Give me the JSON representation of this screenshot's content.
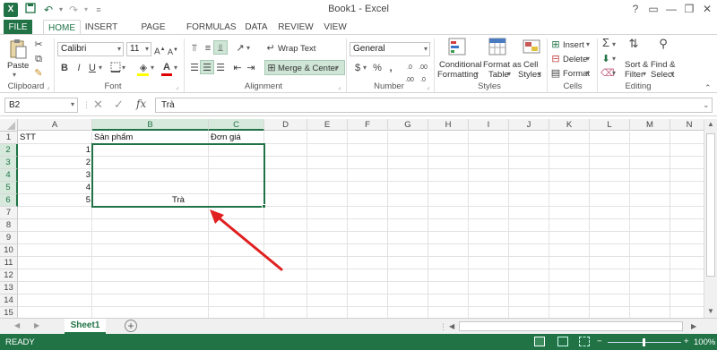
{
  "window": {
    "title": "Book1 - Excel",
    "controls": [
      "?",
      "▭",
      "—",
      "❐",
      "✕"
    ]
  },
  "ribbon_tabs": [
    "FILE",
    "HOME",
    "INSERT",
    "PAGE LAYOUT",
    "FORMULAS",
    "DATA",
    "REVIEW",
    "VIEW"
  ],
  "ribbon": {
    "clipboard": {
      "paste": "Paste",
      "label": "Clipboard"
    },
    "font": {
      "name": "Calibri",
      "size": "11",
      "bold": "B",
      "italic": "I",
      "underline": "U",
      "label": "Font"
    },
    "alignment": {
      "wrap_text": "Wrap Text",
      "merge_center": "Merge & Center",
      "label": "Alignment"
    },
    "number": {
      "format": "General",
      "currency": "$",
      "percent": "%",
      "comma": ",",
      "label": "Number"
    },
    "styles": {
      "conditional": [
        "Conditional",
        "Formatting"
      ],
      "format_as": [
        "Format as",
        "Table"
      ],
      "cell_styles": [
        "Cell",
        "Styles"
      ],
      "label": "Styles"
    },
    "cells": {
      "insert": "Insert",
      "delete": "Delete",
      "format": "Format",
      "label": "Cells"
    },
    "editing": {
      "sort": [
        "Sort &",
        "Filter"
      ],
      "find": [
        "Find &",
        "Select"
      ],
      "label": "Editing"
    }
  },
  "formula_bar": {
    "name_box": "B2",
    "fx": "fx",
    "value": "Trà"
  },
  "columns": [
    "A",
    "B",
    "C",
    "D",
    "E",
    "F",
    "G",
    "H",
    "I",
    "J",
    "K",
    "L",
    "M",
    "N"
  ],
  "rows": [
    "1",
    "2",
    "3",
    "4",
    "5",
    "6",
    "7",
    "8",
    "9",
    "10",
    "11",
    "12",
    "13",
    "14",
    "15"
  ],
  "cells": {
    "A1": "STT",
    "B1": "Sản phẩm",
    "C1": "Đơn giá",
    "A2": "1",
    "A3": "2",
    "A4": "3",
    "A5": "4",
    "A6": "5",
    "B6": "Trà"
  },
  "sheets": {
    "active": "Sheet1",
    "add": "+"
  },
  "status": {
    "mode": "READY",
    "zoom": "100%"
  },
  "accent_color": "#217346"
}
